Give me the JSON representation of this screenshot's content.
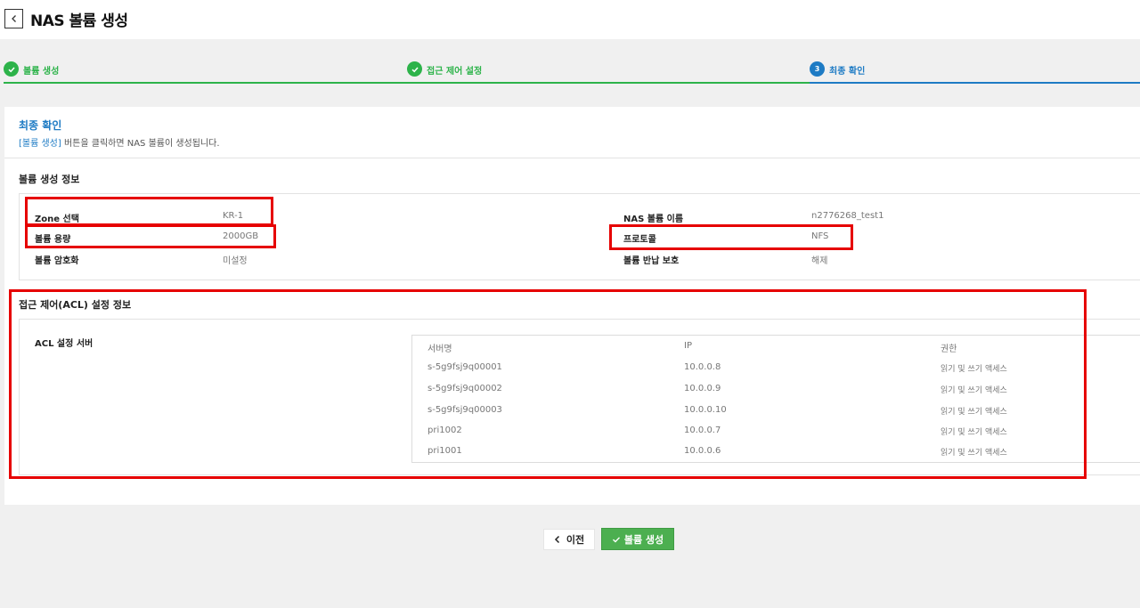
{
  "header": {
    "title": "NAS 볼륨 생성",
    "back_icon": "chevron-left-icon"
  },
  "steps": [
    {
      "label": "볼륨 생성",
      "state": "done",
      "icon": "check-icon"
    },
    {
      "label": "접근 제어 설정",
      "state": "done",
      "icon": "check-icon"
    },
    {
      "label": "최종 확인",
      "state": "active",
      "number": "3"
    }
  ],
  "summary": {
    "title": "최종 확인",
    "desc_highlight": "[볼륨 생성]",
    "desc_rest": " 버튼을 클릭하면 NAS 볼륨이 생성됩니다."
  },
  "volume_info": {
    "title": "볼륨 생성 정보",
    "fields": [
      {
        "label": "Zone 선택",
        "value": "KR-1"
      },
      {
        "label": "볼륨 용량",
        "value": "2000GB"
      },
      {
        "label": "볼륨 암호화",
        "value": "미설정"
      },
      {
        "label": "NAS 볼륨 이름",
        "value": "n2776268_test1"
      },
      {
        "label": "프로토콜",
        "value": "NFS"
      },
      {
        "label": "볼륨 반납 보호",
        "value": "해제"
      }
    ]
  },
  "acl_info": {
    "title": "접근 제어(ACL) 설정 정보",
    "label": "ACL 설정 서버",
    "columns": [
      "서버명",
      "IP",
      "권한"
    ],
    "rows": [
      [
        "s-5g9fsj9q00001",
        "10.0.0.8",
        "읽기 및 쓰기 액세스"
      ],
      [
        "s-5g9fsj9q00002",
        "10.0.0.9",
        "읽기 및 쓰기 액세스"
      ],
      [
        "s-5g9fsj9q00003",
        "10.0.0.10",
        "읽기 및 쓰기 액세스"
      ],
      [
        "pri1002",
        "10.0.0.7",
        "읽기 및 쓰기 액세스"
      ],
      [
        "pri1001",
        "10.0.0.6",
        "읽기 및 쓰기 액세스"
      ]
    ]
  },
  "buttons": {
    "prev_label": "이전",
    "create_label": "볼륨 생성"
  },
  "colors": {
    "done": "#2db34a",
    "active": "#1e7bc4",
    "highlight_box": "#e60000",
    "primary_button": "#4caf50"
  }
}
